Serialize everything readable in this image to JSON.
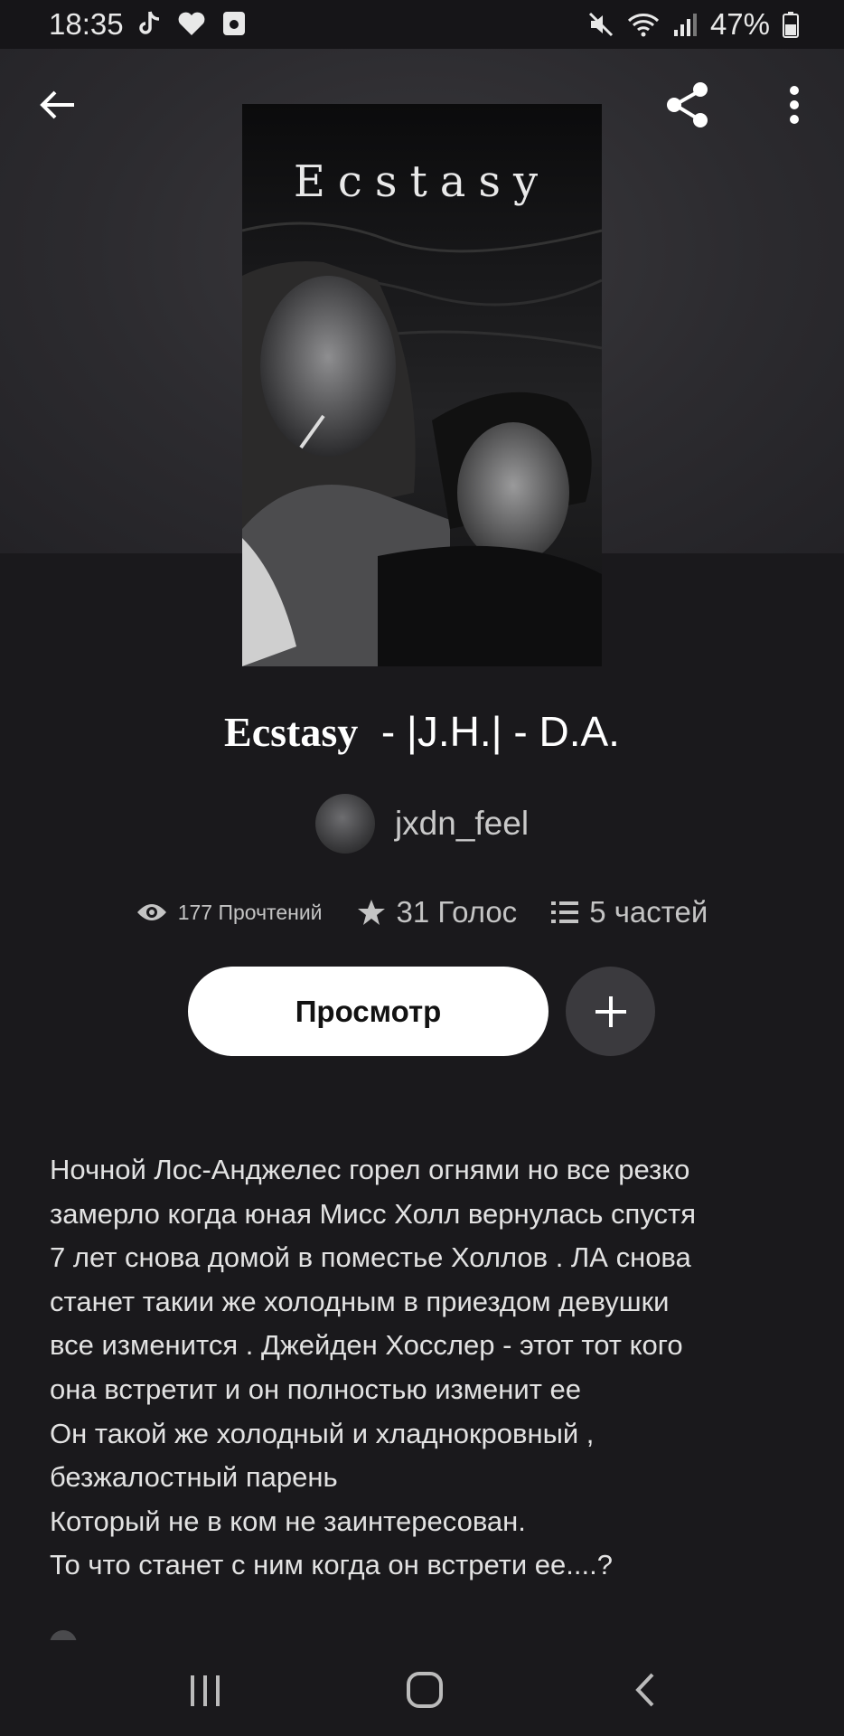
{
  "status_bar": {
    "time": "18:35",
    "battery_pct": "47%",
    "icons": [
      "tiktok-icon",
      "heart-icon",
      "screen-record-icon",
      "mute-icon",
      "wifi-icon",
      "signal-icon",
      "battery-icon"
    ]
  },
  "header": {
    "back_icon": "arrow-left-icon",
    "share_icon": "share-icon",
    "menu_icon": "more-vertical-icon"
  },
  "cover": {
    "title_text": "Ecstasy"
  },
  "book": {
    "title_serif": "Ecstasy",
    "title_rest": "  - |J.H.| - D.A."
  },
  "author": {
    "name": "jxdn_feel"
  },
  "stats": {
    "reads": "177 Прочтений",
    "votes": "31 Голос",
    "parts": "5 частей"
  },
  "actions": {
    "read_label": "Просмотр",
    "add_icon": "plus-icon"
  },
  "description": "Ночной Лос-Анджелес  горел огнями но все резко\nзамерло  когда юная Мисс Холл  вернулась спустя\n7 лет снова домой  в поместье Холлов  .  ЛА снова\nстанет такии же холодным в приездом девушки\nвсе изменится  . Джейден Хосслер - этот тот кого\nона встретит и он полностью изменит ее\nОн такой же холодный  и хладнокровный ,\nбезжалостный парень\nКоторый не в ком не заинтересован.\nТо что станет с ним  когда он встрети  ее....?",
  "colors": {
    "background": "#1a191c",
    "header_bg": "#2c2b2f",
    "primary_button": "#ffffff",
    "secondary_button": "#3b3a3e"
  }
}
